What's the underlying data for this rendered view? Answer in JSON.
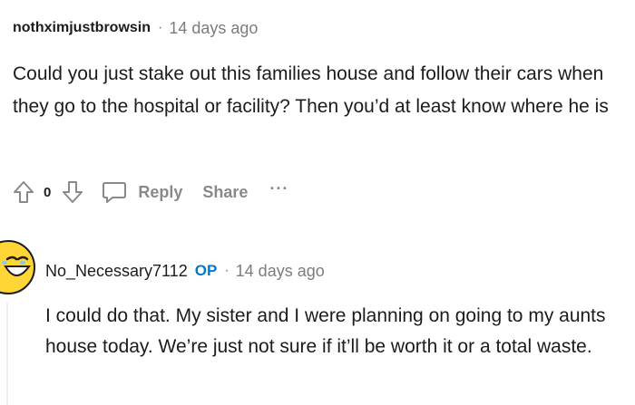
{
  "comment": {
    "author": "nothximjustbrowsin",
    "separator": "·",
    "time_ago": "14 days ago",
    "body": "Could you just stake out this families house and follow their cars when they go to the hospital or facility? Then you’d at least know where he is",
    "vote_count": "0",
    "actions": {
      "reply": "Reply",
      "share": "Share",
      "more": "···"
    },
    "icons": {
      "upvote": "arrow-up-outline",
      "downvote": "arrow-down-outline",
      "comment": "speech-bubble-outline"
    }
  },
  "reply": {
    "author": "No_Necessary7112",
    "op_badge": "OP",
    "separator": "·",
    "time_ago": "14 days ago",
    "body": "I could do that. My sister and I were planning on going to my aunts house today. We’re just not sure if it’ll be worth it or a total waste.",
    "avatar": "yellow-laughing-snoo-avatar"
  },
  "colors": {
    "text": "#1c1c1c",
    "meta": "#7c7c7c",
    "action": "#878a8c",
    "op": "#0079d3",
    "thread_line": "#edeff1"
  }
}
